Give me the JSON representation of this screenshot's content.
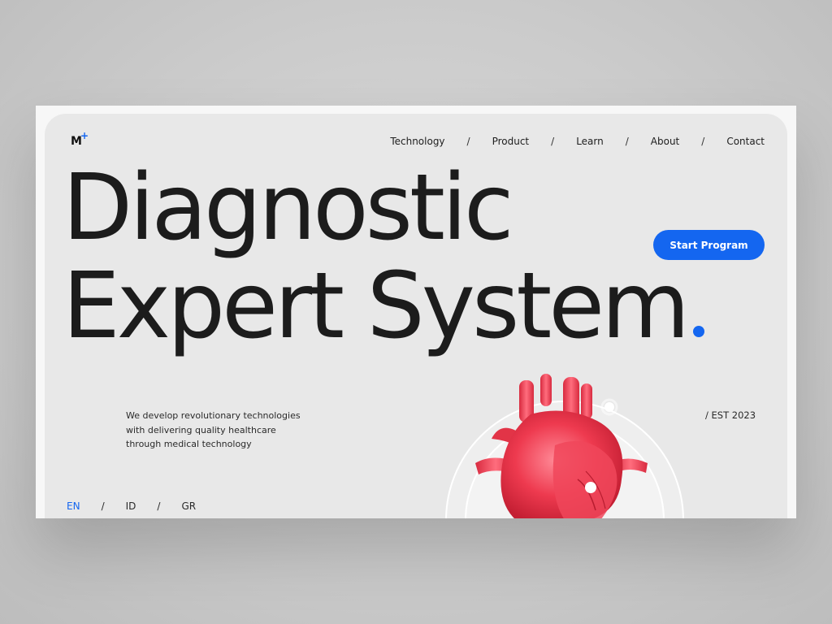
{
  "brand": {
    "logo_text": "M",
    "logo_mark": "+"
  },
  "nav": {
    "items": [
      "Technology",
      "Product",
      "Learn",
      "About",
      "Contact"
    ],
    "separator": "/"
  },
  "hero": {
    "line1": "Diagnostic",
    "line2": "Expert System",
    "cta_label": "Start Program"
  },
  "description": {
    "lines": [
      "We develop revolutionary technologies",
      "with delivering quality healthcare",
      "through medical technology"
    ]
  },
  "est": "/ EST 2023",
  "languages": {
    "items": [
      "EN",
      "ID",
      "GR"
    ],
    "active": "EN",
    "separator": "/"
  },
  "visual": {
    "icon": "anatomical-heart-icon"
  },
  "colors": {
    "accent": "#1466f0",
    "heart": "#ee3a4f",
    "text": "#1c1c1c",
    "card": "#e8e8e8"
  }
}
